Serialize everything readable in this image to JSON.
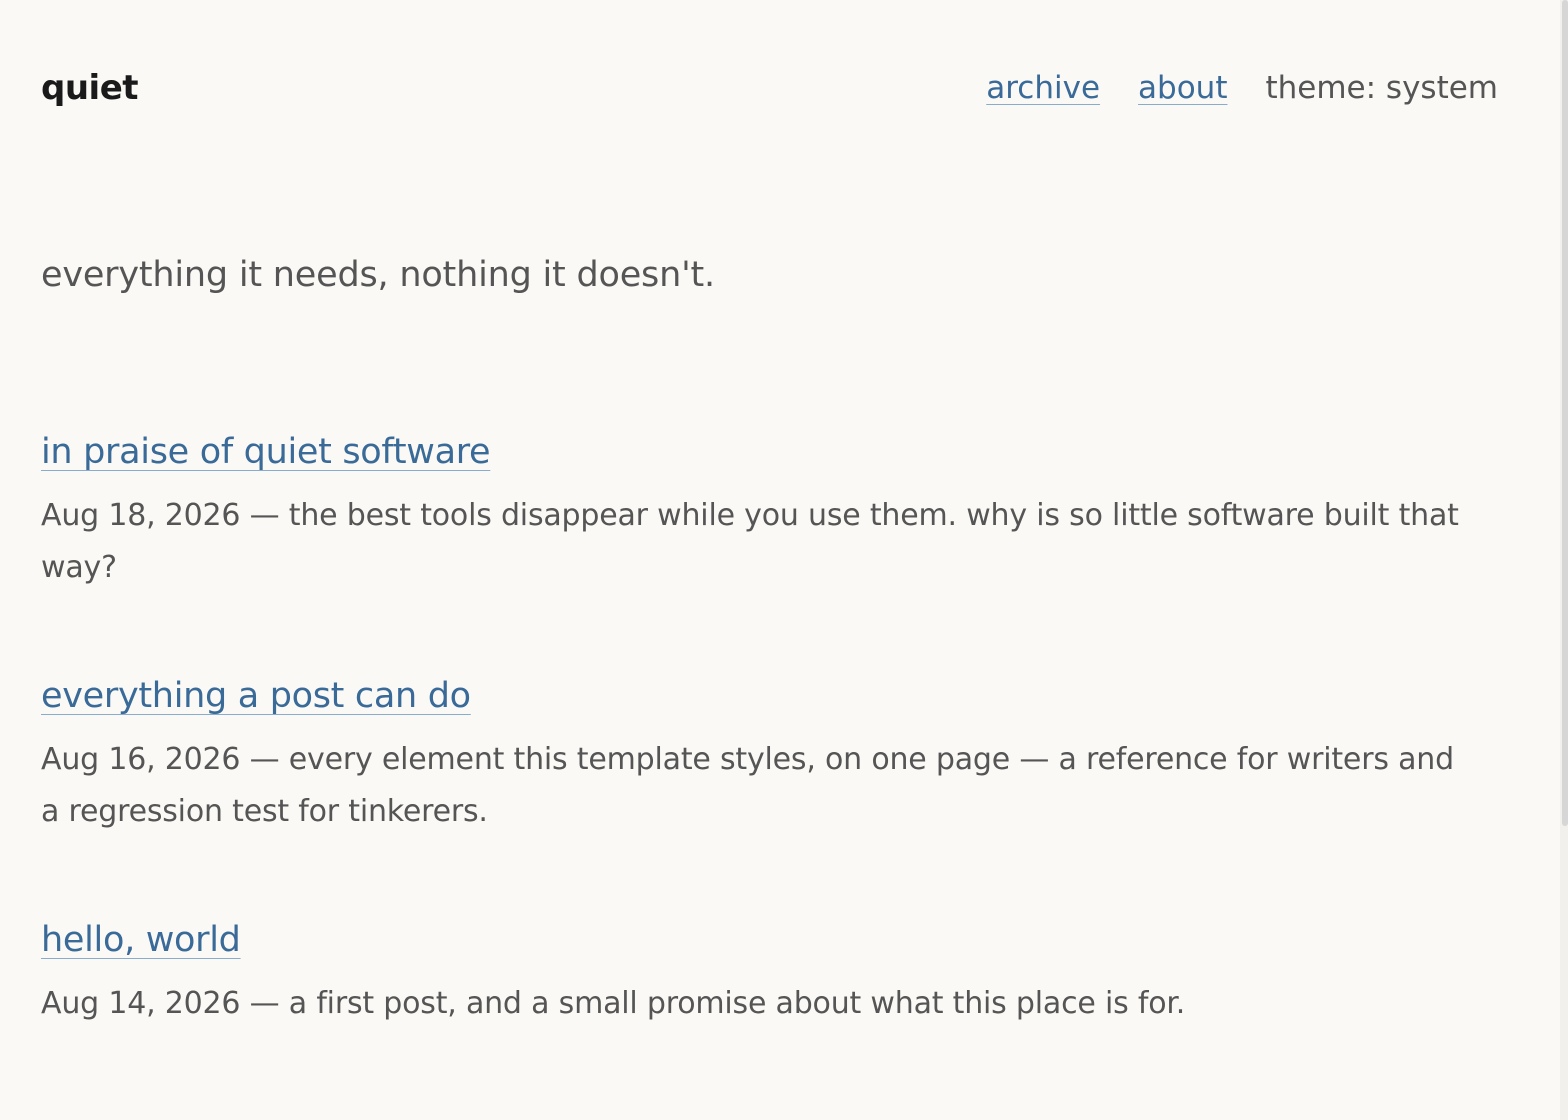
{
  "header": {
    "site_title": "quiet",
    "nav": {
      "archive": "archive",
      "about": "about",
      "theme": "theme: system"
    }
  },
  "tagline": "everything it needs, nothing it doesn't.",
  "posts": [
    {
      "title": "in praise of quiet software",
      "date": "Aug 18, 2026",
      "summary": "the best tools disappear while you use them. why is so little software built that way?"
    },
    {
      "title": "everything a post can do",
      "date": "Aug 16, 2026",
      "summary": "every element this template styles, on one page — a reference for writers and a regression test for tinkerers."
    },
    {
      "title": "hello, world",
      "date": "Aug 14, 2026",
      "summary": "a first post, and a small promise about what this place is for."
    }
  ],
  "separator": " — ",
  "colors": {
    "background": "#faf9f6",
    "link": "#3a6a98",
    "text": "#555555",
    "title": "#1a1a1a"
  }
}
